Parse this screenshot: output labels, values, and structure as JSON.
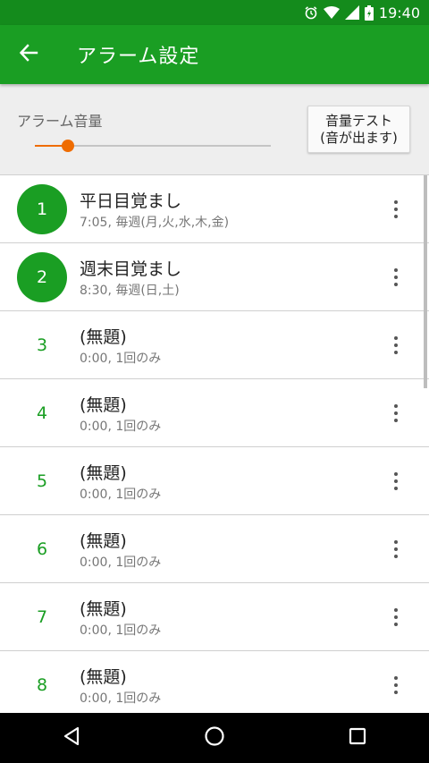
{
  "status_bar": {
    "time": "19:40",
    "icons": [
      "alarm-clock-icon",
      "wifi-icon",
      "signal-icon",
      "battery-charging-icon"
    ]
  },
  "app_bar": {
    "title": "アラーム設定",
    "back_icon": "arrow-left-icon"
  },
  "volume": {
    "label": "アラーム音量",
    "level_fraction": 0.14,
    "test_button_line1": "音量テスト",
    "test_button_line2": "(音が出ます)",
    "accent_color": "#ef6c00"
  },
  "colors": {
    "primary": "#1a9e23",
    "primary_dark": "#148b1c"
  },
  "alarms": [
    {
      "number": "1",
      "title": "平日目覚まし",
      "subtitle": "7:05, 毎週(月,火,水,木,金)",
      "enabled": true
    },
    {
      "number": "2",
      "title": "週末目覚まし",
      "subtitle": "8:30, 毎週(日,土)",
      "enabled": true
    },
    {
      "number": "3",
      "title": "(無題)",
      "subtitle": "0:00, 1回のみ",
      "enabled": false
    },
    {
      "number": "4",
      "title": "(無題)",
      "subtitle": "0:00, 1回のみ",
      "enabled": false
    },
    {
      "number": "5",
      "title": "(無題)",
      "subtitle": "0:00, 1回のみ",
      "enabled": false
    },
    {
      "number": "6",
      "title": "(無題)",
      "subtitle": "0:00, 1回のみ",
      "enabled": false
    },
    {
      "number": "7",
      "title": "(無題)",
      "subtitle": "0:00, 1回のみ",
      "enabled": false
    },
    {
      "number": "8",
      "title": "(無題)",
      "subtitle": "0:00, 1回のみ",
      "enabled": false
    }
  ],
  "nav_bar": {
    "icons": [
      "back-triangle-icon",
      "home-circle-icon",
      "recents-square-icon"
    ]
  }
}
